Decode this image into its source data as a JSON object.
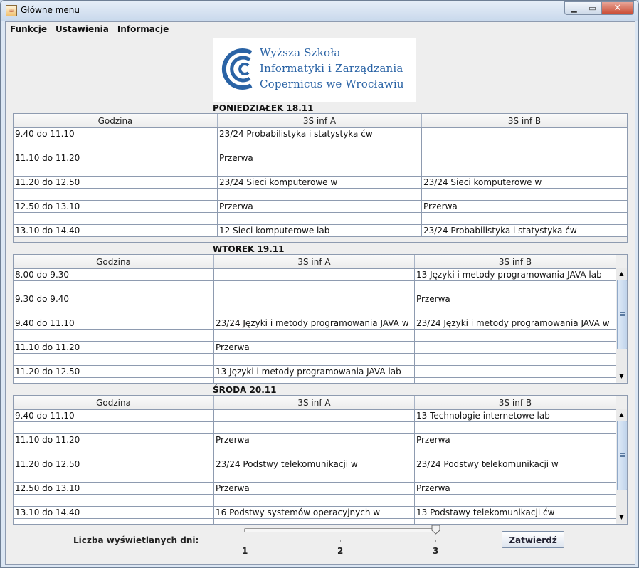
{
  "window": {
    "title": "Główne menu",
    "app_icon": "java-cup-icon"
  },
  "menubar": {
    "items": [
      "Funkcje",
      "Ustawienia",
      "Informacje"
    ]
  },
  "logo": {
    "lines": [
      "Wyższa Szkoła",
      "Informatyki i Zarządzania",
      "Copernicus we Wrocławiu"
    ],
    "color": "#2a63a5"
  },
  "days": [
    {
      "title": "PONIEDZIAŁEK 18.11",
      "headers": [
        "Godzina",
        "3S inf A",
        "3S inf B"
      ],
      "rows": [
        [
          "9.40 do 11.10",
          "23/24 Probabilistyka i statystyka ćw",
          ""
        ],
        [
          "",
          "",
          ""
        ],
        [
          "11.10 do 11.20",
          "Przerwa",
          ""
        ],
        [
          "",
          "",
          ""
        ],
        [
          "11.20 do 12.50",
          "23/24 Sieci komputerowe w",
          "23/24 Sieci komputerowe w"
        ],
        [
          "",
          "",
          ""
        ],
        [
          "12.50 do 13.10",
          "Przerwa",
          "Przerwa"
        ],
        [
          "",
          "",
          ""
        ],
        [
          "13.10 do 14.40",
          " 12 Sieci komputerowe lab",
          "23/24 Probabilistyka i statystyka ćw"
        ]
      ]
    },
    {
      "title": "WTOREK 19.11",
      "headers": [
        "Godzina",
        "3S inf A",
        "3S inf B"
      ],
      "rows": [
        [
          "8.00 do 9.30",
          "",
          "13 Języki i metody programowania JAVA lab"
        ],
        [
          "",
          "",
          ""
        ],
        [
          "9.30 do 9.40",
          "",
          "Przerwa"
        ],
        [
          "",
          "",
          ""
        ],
        [
          "9.40 do 11.10",
          "23/24 Języki i metody programowania JAVA w",
          "23/24 Języki i metody programowania JAVA w"
        ],
        [
          "",
          "",
          ""
        ],
        [
          "11.10 do 11.20",
          "Przerwa",
          ""
        ],
        [
          "",
          "",
          ""
        ],
        [
          "11.20 do 12.50",
          "13 Języki i metody programowania JAVA lab",
          ""
        ],
        [
          "",
          "",
          ""
        ]
      ]
    },
    {
      "title": "ŚRODA 20.11",
      "headers": [
        "Godzina",
        "3S inf A",
        "3S inf B"
      ],
      "rows": [
        [
          "9.40 do 11.10",
          "",
          " 13 Technologie internetowe lab"
        ],
        [
          "",
          "",
          ""
        ],
        [
          "11.10 do 11.20",
          "Przerwa",
          "Przerwa"
        ],
        [
          "",
          "",
          ""
        ],
        [
          "11.20 do 12.50",
          "23/24 Podstwy telekomunikacji w",
          "23/24 Podstwy telekomunikacji w"
        ],
        [
          "",
          "",
          ""
        ],
        [
          "12.50 do 13.10",
          "Przerwa",
          "Przerwa"
        ],
        [
          "",
          "",
          ""
        ],
        [
          "13.10 do 14.40",
          "16 Podstwy systemów operacyjnych w",
          "13 Podstawy telekomunikacji ćw"
        ],
        [
          "",
          "",
          ""
        ]
      ]
    }
  ],
  "footer": {
    "days_label": "Liczba wyświetlanych dni:",
    "slider": {
      "min": 1,
      "max": 3,
      "value": 3,
      "ticks": [
        "1",
        "2",
        "3"
      ]
    },
    "confirm_label": "Zatwierdź"
  }
}
